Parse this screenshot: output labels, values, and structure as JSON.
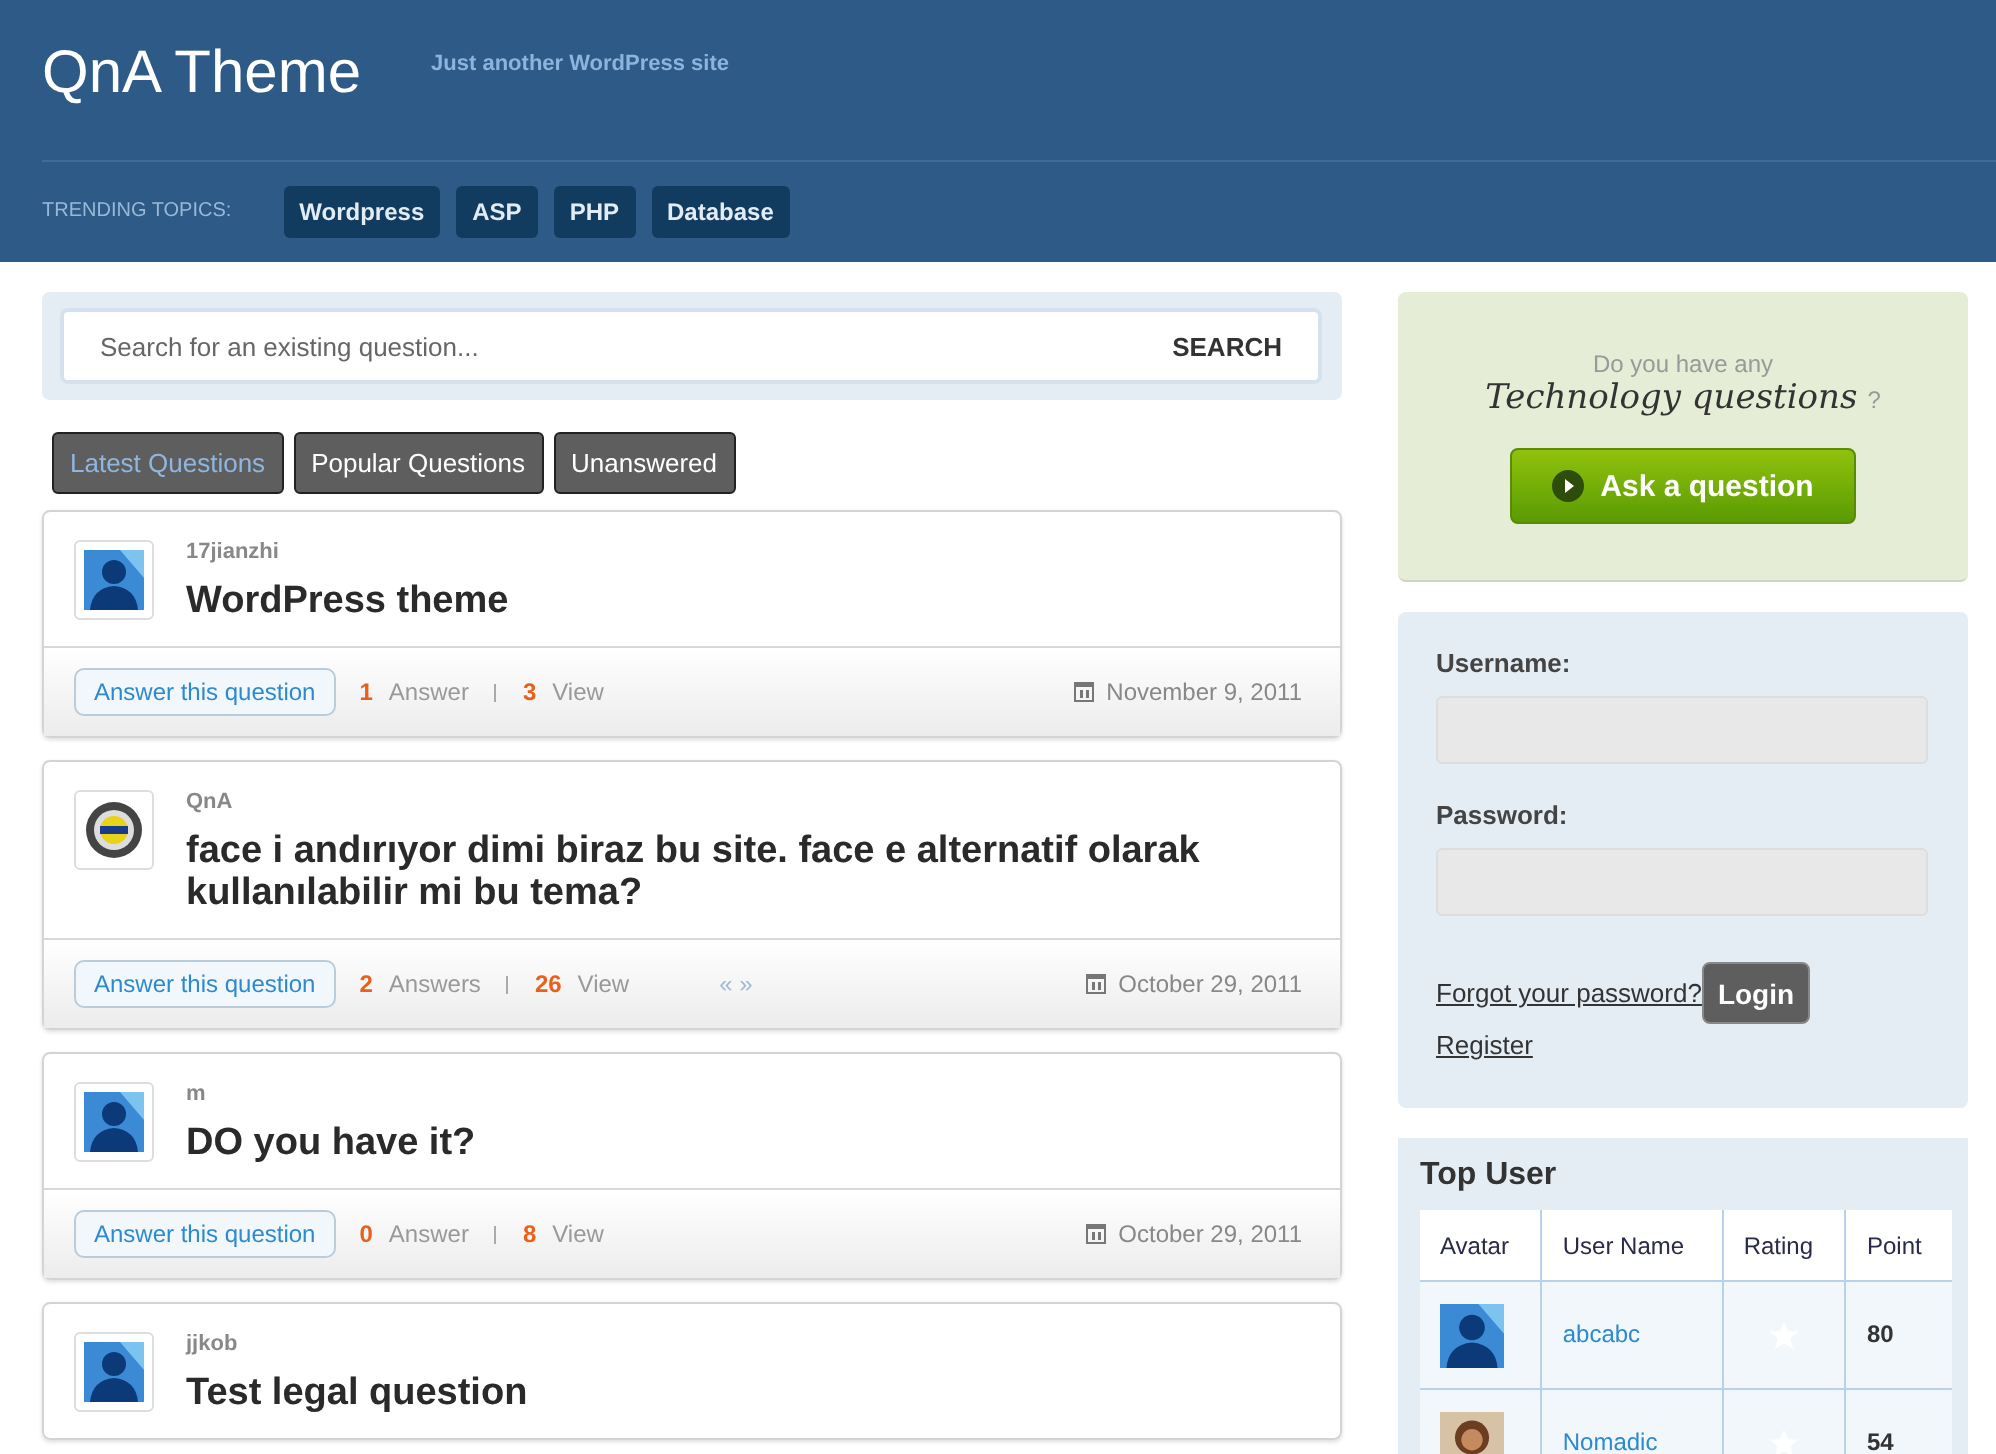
{
  "site": {
    "title": "QnA Theme",
    "tagline": "Just another WordPress site"
  },
  "trending": {
    "label": "TRENDING TOPICS:",
    "topics": [
      "Wordpress",
      "ASP",
      "PHP",
      "Database"
    ]
  },
  "search": {
    "placeholder": "Search for an existing question...",
    "button": "SEARCH"
  },
  "tabs": [
    {
      "label": "Latest Questions",
      "selected": true
    },
    {
      "label": "Popular Questions",
      "selected": false
    },
    {
      "label": "Unanswered",
      "selected": false
    }
  ],
  "questions": [
    {
      "author": "17jianzhi",
      "kind": "silhouette",
      "title": "WordPress theme",
      "answer_button": "Answer this question",
      "answers": "1",
      "answers_label": "Answer",
      "views": "3",
      "views_label": "View",
      "date": "November 9, 2011"
    },
    {
      "author": "QnA",
      "kind": "emblem",
      "title": "face i andırıyor dimi biraz bu site. face e alternatif olarak kullanılabilir mi bu tema?",
      "answer_button": "Answer this question",
      "answers": "2",
      "answers_label": "Answers",
      "views": "26",
      "views_label": "View",
      "pager": "« »",
      "date": "October 29, 2011"
    },
    {
      "author": "m",
      "kind": "silhouette",
      "title": "DO you have it?",
      "answer_button": "Answer this question",
      "answers": "0",
      "answers_label": "Answer",
      "views": "8",
      "views_label": "View",
      "date": "October 29, 2011"
    },
    {
      "author": "jjkob",
      "kind": "silhouette",
      "title": "Test legal question"
    }
  ],
  "ask": {
    "line1": "Do you have any",
    "line2": "Technology questions",
    "mark": "?",
    "button": "Ask a question"
  },
  "login": {
    "username_label": "Username:",
    "password_label": "Password:",
    "forgot": "Forgot your password?",
    "login_button": "Login",
    "register": "Register"
  },
  "top_users": {
    "title": "Top User",
    "columns": [
      "Avatar",
      "User Name",
      "Rating",
      "Point"
    ],
    "rows": [
      {
        "kind": "silhouette",
        "name": "abcabc",
        "point": "80"
      },
      {
        "name": "Nomadic",
        "point": "54"
      }
    ]
  }
}
